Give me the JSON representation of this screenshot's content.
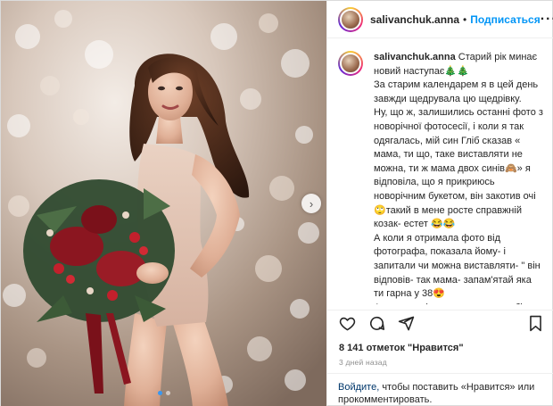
{
  "header": {
    "username": "salivanchuk.anna",
    "separator": "•",
    "follow_label": "Подписаться",
    "more_icon": "more-icon"
  },
  "caption": {
    "username": "salivanchuk.anna",
    "text": " Старий рік минає новий наступає🎄🎄\nЗа старим календарем я в цей день завжди щедрувала цю щедрівку.\nНу, що ж, залишились останні фото з новорічної фотосесії, і коли я так одягалась, мій син Гліб сказав « мама, ти що, таке виставляти не можна, ти ж мама двох синів🙈» я відповіла, що я прикриюсь новорічним букетом, він закотив очі 🙄такий в мене росте справжній козак- естет 😂😂\nА коли я отримала фото від фотографа, показала йому- і запитали чи можна виставляти- \" він відповів- так мама- запам'ятай яка ти гарна у 38😍\nА насправді це нагадування собі про те, що до відпочинку я так гарно"
  },
  "actions": {
    "like_icon": "heart-icon",
    "comment_icon": "comment-icon",
    "share_icon": "share-icon",
    "save_icon": "bookmark-icon"
  },
  "likes_text": "8 141 отметок \"Нравится\"",
  "timestamp": "3 дней назад",
  "login_note": {
    "link": "Войдите,",
    "rest": " чтобы поставить «Нравится» или прокомментировать."
  },
  "carousel": {
    "next_label": "›",
    "slides": 2,
    "active_index": 0
  },
  "colors": {
    "follow": "#0095f6",
    "link": "#00376b",
    "muted": "#8e8e8e",
    "active_dot": "#3897f0"
  }
}
